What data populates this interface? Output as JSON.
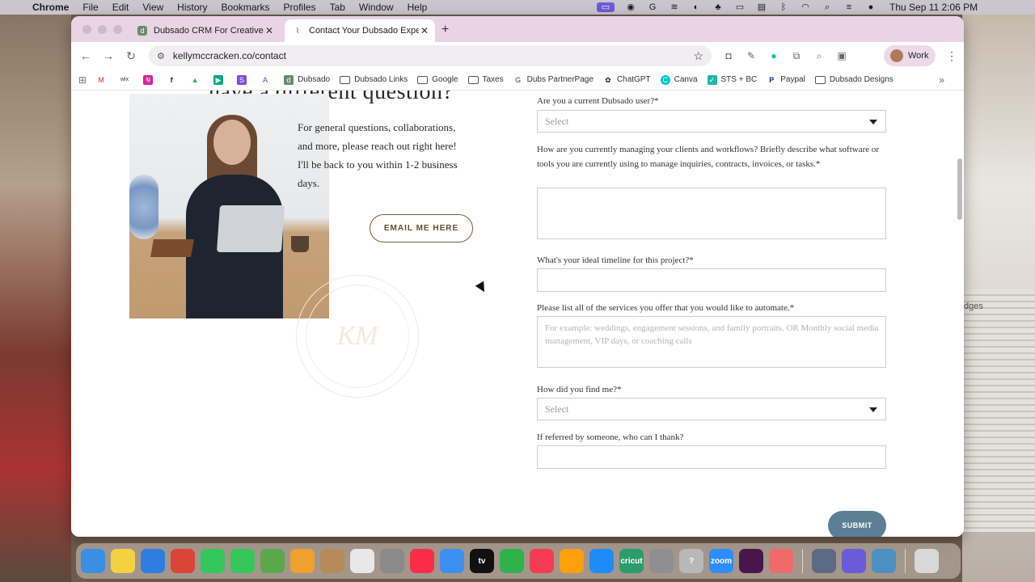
{
  "menubar": {
    "app": "Chrome",
    "items": [
      "File",
      "Edit",
      "View",
      "History",
      "Bookmarks",
      "Profiles",
      "Tab",
      "Window",
      "Help"
    ],
    "clock": "Thu Sep 11  2:06 PM"
  },
  "browser": {
    "tabs": [
      {
        "title": "Dubsado CRM For Creatives",
        "favicon": "d"
      },
      {
        "title": "Contact Your Dubsado Expert",
        "favicon": "k"
      }
    ],
    "url": "kellymccracken.co/contact",
    "profile": "Work",
    "bookmarks": [
      {
        "label": "",
        "icon": "M",
        "color": "#d93025"
      },
      {
        "label": "",
        "icon": "wix",
        "color": "#333333"
      },
      {
        "label": "",
        "icon": "ig",
        "color": "#d6249f"
      },
      {
        "label": "",
        "icon": "f",
        "color": "#1877f2"
      },
      {
        "label": "",
        "icon": "▲",
        "color": "#34a853"
      },
      {
        "label": "",
        "icon": "▶",
        "color": "#00a884"
      },
      {
        "label": "",
        "icon": "S",
        "color": "#7b4ddb"
      },
      {
        "label": "",
        "icon": "A",
        "color": "#5b3fd1"
      },
      {
        "label": "Dubsado",
        "icon": "d",
        "color": "#6a8a6f"
      },
      {
        "label": "Dubsado Links",
        "icon": "folder"
      },
      {
        "label": "Google",
        "icon": "folder"
      },
      {
        "label": "Taxes",
        "icon": "folder"
      },
      {
        "label": "Dubs PartnerPage",
        "icon": "G",
        "color": "#444444"
      },
      {
        "label": "ChatGPT",
        "icon": "✿",
        "color": "#222222"
      },
      {
        "label": "Canva",
        "icon": "C",
        "color": "#00c4cc"
      },
      {
        "label": "STS + BC",
        "icon": "✓",
        "color": "#27b5a4"
      },
      {
        "label": "Paypal",
        "icon": "P",
        "color": "#003087"
      },
      {
        "label": "Dubsado Designs",
        "icon": "folder"
      }
    ]
  },
  "page": {
    "heading": "have a different question?",
    "blurb": "For general questions, collaborations, and more, please reach out right here! I'll be back to you within 1-2 business days.",
    "email_button": "EMAIL ME HERE",
    "watermark": "KM",
    "form": {
      "q1": "Are you a current Dubsado user?*",
      "q1_value": "Select",
      "q2": "How are you currently managing your clients and workflows? Briefly describe what software or tools you are currently using to manage inquiries, contracts, invoices, or tasks.*",
      "q3": "What's your ideal timeline for this project?*",
      "q4": "Please list all of the services you offer that you would like to automate.*",
      "q4_placeholder": "For example: weddings, engagement sessions, and family portraits. OR Monthly social media management, VIP days, or coaching calls",
      "q5": "How did you find me?*",
      "q5_value": "Select",
      "q6": "If referred by someone, who can I thank?",
      "submit": "SUBMIT"
    }
  },
  "desktop": {
    "side_text": "dges"
  },
  "dock": [
    {
      "name": "finder",
      "color": "#3a8ee6",
      "label": ""
    },
    {
      "name": "notes",
      "color": "#f5d142",
      "label": ""
    },
    {
      "name": "freeform",
      "color": "#2f7de1",
      "label": ""
    },
    {
      "name": "chrome",
      "color": "#db4437",
      "label": ""
    },
    {
      "name": "facetime",
      "color": "#34c759",
      "label": ""
    },
    {
      "name": "messages",
      "color": "#34c759",
      "label": ""
    },
    {
      "name": "maps",
      "color": "#59a84b",
      "label": ""
    },
    {
      "name": "photos",
      "color": "#f0a030",
      "label": ""
    },
    {
      "name": "contacts",
      "color": "#b88a5a",
      "label": ""
    },
    {
      "name": "reminders",
      "color": "#e8e8e8",
      "label": ""
    },
    {
      "name": "launchpad",
      "color": "#8a8a8a",
      "label": ""
    },
    {
      "name": "music",
      "color": "#fa2d48",
      "label": ""
    },
    {
      "name": "mail",
      "color": "#3b8ff0",
      "label": ""
    },
    {
      "name": "tv",
      "color": "#111111",
      "label": "tv"
    },
    {
      "name": "numbers",
      "color": "#31b14b",
      "label": ""
    },
    {
      "name": "news",
      "color": "#f53b52",
      "label": ""
    },
    {
      "name": "pages",
      "color": "#ff9f0a",
      "label": ""
    },
    {
      "name": "app-store",
      "color": "#1d8cf8",
      "label": ""
    },
    {
      "name": "cricut",
      "color": "#2c9c6a",
      "label": "cricut"
    },
    {
      "name": "system-settings",
      "color": "#8e8e93",
      "label": ""
    },
    {
      "name": "help",
      "color": "#b8b8b8",
      "label": "?"
    },
    {
      "name": "zoom",
      "color": "#2d8cff",
      "label": "zoom"
    },
    {
      "name": "slack",
      "color": "#4a154b",
      "label": ""
    },
    {
      "name": "asana",
      "color": "#f06a6a",
      "label": ""
    },
    {
      "name": "preview",
      "color": "#5b6b85",
      "label": ""
    },
    {
      "name": "perplexity",
      "color": "#6b5bd8",
      "label": ""
    },
    {
      "name": "quicktime",
      "color": "#4a90c2",
      "label": ""
    },
    {
      "name": "trash",
      "color": "#d8d8d8",
      "label": ""
    }
  ]
}
